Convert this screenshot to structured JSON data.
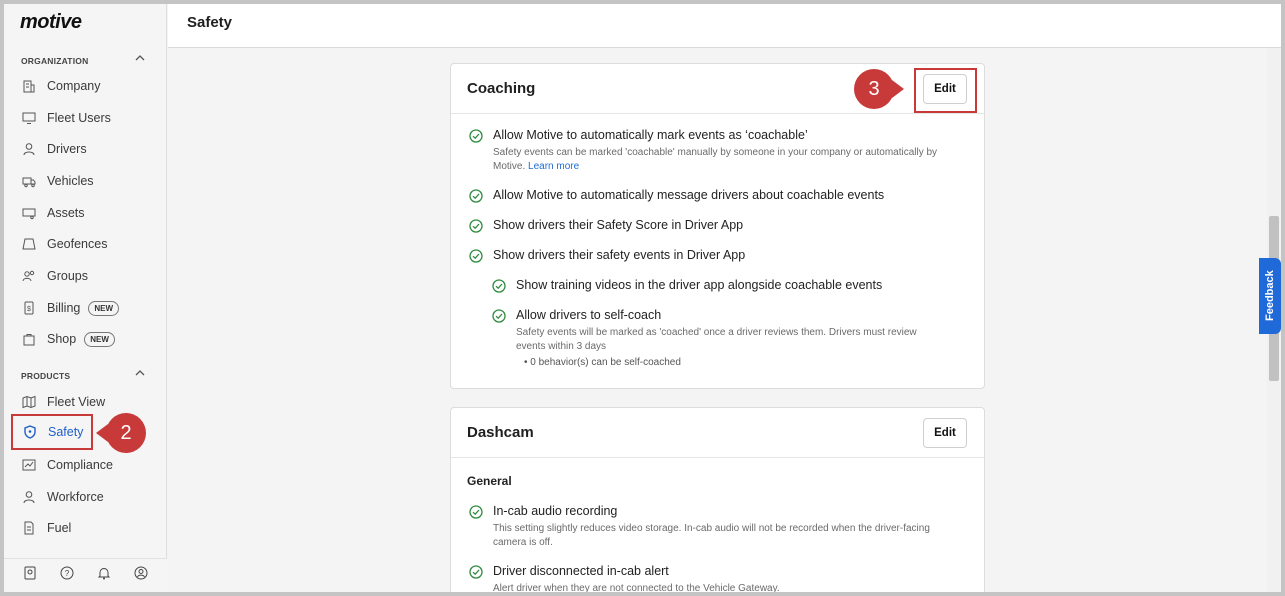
{
  "app": {
    "logo": "motive"
  },
  "header": {
    "title": "Safety"
  },
  "sidebar": {
    "sections": {
      "organization": "ORGANIZATION",
      "products": "PRODUCTS"
    },
    "org_items": [
      {
        "label": "Company",
        "icon": "building-icon"
      },
      {
        "label": "Fleet Users",
        "icon": "monitor-icon"
      },
      {
        "label": "Drivers",
        "icon": "person-icon"
      },
      {
        "label": "Vehicles",
        "icon": "truck-icon"
      },
      {
        "label": "Assets",
        "icon": "trailer-icon"
      },
      {
        "label": "Geofences",
        "icon": "geofence-icon"
      },
      {
        "label": "Groups",
        "icon": "group-icon"
      },
      {
        "label": "Billing",
        "icon": "billing-icon",
        "badge": "NEW"
      },
      {
        "label": "Shop",
        "icon": "bag-icon",
        "badge": "NEW"
      }
    ],
    "product_items": [
      {
        "label": "Fleet View",
        "icon": "map-icon"
      },
      {
        "label": "Safety",
        "icon": "shield-icon",
        "active": true
      },
      {
        "label": "Compliance",
        "icon": "chart-icon"
      },
      {
        "label": "Workforce",
        "icon": "person-icon"
      },
      {
        "label": "Fuel",
        "icon": "document-icon"
      }
    ]
  },
  "callouts": {
    "step2": "2",
    "step3": "3"
  },
  "coaching": {
    "title": "Coaching",
    "edit_label": "Edit",
    "settings": [
      {
        "label": "Allow Motive to automatically mark events as ‘coachable’",
        "desc": "Safety events can be marked 'coachable' manually by someone in your company or automatically by Motive.",
        "link": "Learn more"
      },
      {
        "label": "Allow Motive to automatically message drivers about coachable events"
      },
      {
        "label": "Show drivers their Safety Score in Driver App"
      },
      {
        "label": "Show drivers their safety events in Driver App"
      },
      {
        "label": "Show training videos in the driver app alongside coachable events"
      },
      {
        "label": "Allow drivers to self-coach",
        "desc": "Safety events will be marked as 'coached' once a driver reviews them. Drivers must review events within 3 days",
        "bullet": "0 behavior(s) can be self-coached"
      }
    ]
  },
  "dashcam": {
    "title": "Dashcam",
    "edit_label": "Edit",
    "subhead": "General",
    "settings": [
      {
        "label": "In-cab audio recording",
        "desc": "This setting slightly reduces video storage. In-cab audio will not be recorded when the driver-facing camera is off."
      },
      {
        "label": "Driver disconnected in-cab alert",
        "desc": "Alert driver when they are not connected to the Vehicle Gateway."
      }
    ]
  },
  "feedback": {
    "label": "Feedback"
  },
  "colors": {
    "accent": "#1f6ad8",
    "callout": "#c8393a",
    "check": "#2e8b3d"
  }
}
